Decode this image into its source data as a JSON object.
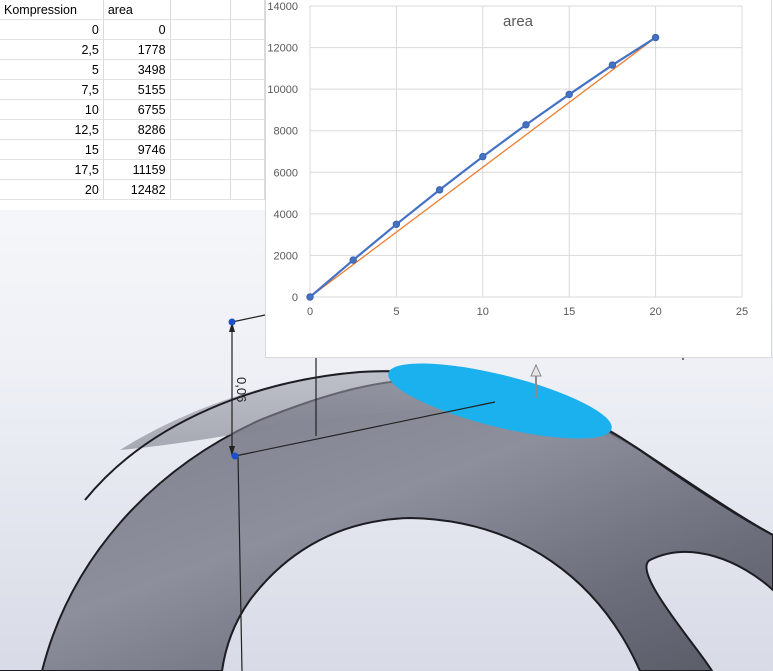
{
  "spreadsheet": {
    "headers": [
      "Kompression",
      "area"
    ],
    "rows": [
      [
        "0",
        "0"
      ],
      [
        "2,5",
        "1778"
      ],
      [
        "5",
        "3498"
      ],
      [
        "7,5",
        "5155"
      ],
      [
        "10",
        "6755"
      ],
      [
        "12,5",
        "8286"
      ],
      [
        "15",
        "9746"
      ],
      [
        "17,5",
        "11159"
      ],
      [
        "20",
        "12482"
      ]
    ]
  },
  "viewport": {
    "dimension_label": "0,06",
    "selection_color": "#1ab1ee",
    "body_color": "#6f7180"
  },
  "chart_data": {
    "type": "line",
    "title": "area",
    "xlabel": "",
    "ylabel": "",
    "xlim": [
      0,
      25
    ],
    "ylim": [
      0,
      14000
    ],
    "xticks": [
      "0",
      "5",
      "10",
      "15",
      "20",
      "25"
    ],
    "yticks": [
      "0",
      "2000",
      "4000",
      "6000",
      "8000",
      "10000",
      "12000",
      "14000"
    ],
    "grid": true,
    "legend": "none",
    "series": [
      {
        "color": "#4472c4",
        "marker": true,
        "x": [
          0,
          2.5,
          5,
          7.5,
          10,
          12.5,
          15,
          17.5,
          20
        ],
        "y": [
          0,
          1778,
          3498,
          5155,
          6755,
          8286,
          9746,
          11159,
          12482
        ]
      },
      {
        "color": "#ed7d31",
        "marker": false,
        "x": [
          0,
          20
        ],
        "y": [
          0,
          12482
        ]
      }
    ]
  }
}
